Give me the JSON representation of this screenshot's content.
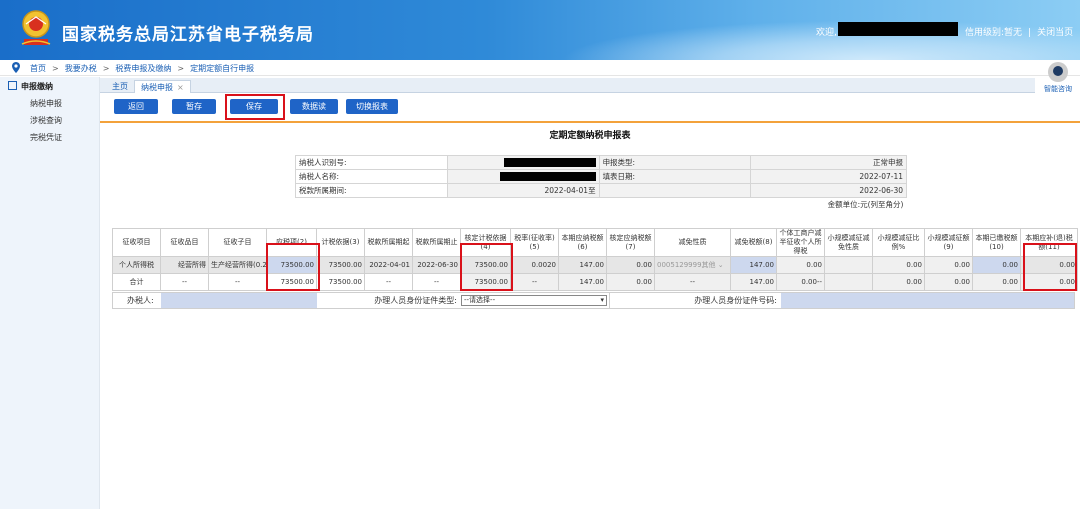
{
  "header": {
    "site_title": "国家税务总局江苏省电子税务局",
    "welcome": "欢迎,",
    "credit_label": "信用级别:暂无",
    "divider": "|",
    "close_label": "关闭当页"
  },
  "breadcrumb": [
    "首页",
    "我要办税",
    "税费申报及缴纳",
    "定期定额自行申报"
  ],
  "breadcrumb_sep": ">",
  "sidebar": {
    "heading": "申报缴纳",
    "items": [
      "纳税申报",
      "涉税查询",
      "完税凭证"
    ]
  },
  "tabs": {
    "home": "主页",
    "active": "纳税申报",
    "close": "×"
  },
  "assistant": {
    "label": "智能咨询"
  },
  "toolbar": {
    "back": "返回",
    "stash": "暂存",
    "save": "保存",
    "fetch": "数据读取",
    "switch": "切换报表"
  },
  "form_title": "定期定额纳税申报表",
  "info": {
    "taxpayer_id_label": "纳税人识别号:",
    "report_type_label": "申报类型:",
    "report_type_value": "正常申报",
    "taxpayer_name_label": "纳税人名称:",
    "fill_date_label": "填表日期:",
    "fill_date_value": "2022-07-11",
    "period_label": "税款所属期间:",
    "period_start": "2022-04-01",
    "period_to": "至",
    "period_end": "2022-06-30",
    "unit_note": "金额单位:元(列至角分)"
  },
  "table": {
    "headers": [
      "征收项目",
      "征收品目",
      "征收子目",
      "应税项(2)",
      "计税依据(3)",
      "税款所属期起",
      "税款所属期止",
      "核定计税依据(4)",
      "税率(征收率)(5)",
      "本期应纳税额(6)",
      "核定应纳税额(7)",
      "减免性质",
      "减免税额(8)",
      "个体工商户减半征收个人所得税",
      "小规模减征减免性质",
      "小规模减征比例%",
      "小规模减征额(9)",
      "本期已缴税额(10)",
      "本期应补(退)税额(11)"
    ],
    "row1": {
      "item": "个人所得税",
      "category": "经营所得",
      "subcategory": "生产经营所得(0.2%",
      "taxable": "73500.00",
      "basis": "73500.00",
      "start": "2022-04-01",
      "end": "2022-06-30",
      "approved_basis": "73500.00",
      "rate": "0.0020",
      "payable": "147.00",
      "approved_payable": "0.00",
      "relief_type": "0005129999其他",
      "relief_amount": "147.00",
      "half_relief": "0.00",
      "small_type": "",
      "small_ratio": "0.00",
      "small_amount": "0.00",
      "paid": "0.00",
      "due": "0.00"
    },
    "row2": {
      "item": "合计",
      "category": "--",
      "subcategory": "--",
      "taxable": "73500.00",
      "basis": "73500.00",
      "start": "--",
      "end": "--",
      "approved_basis": "73500.00",
      "rate": "--",
      "payable": "147.00",
      "approved_payable": "0.00",
      "relief_type": "--",
      "relief_amount": "147.00",
      "half_relief": "0.00--",
      "small_type": "",
      "small_ratio": "0.00",
      "small_amount": "0.00",
      "paid": "0.00",
      "due": "0.00"
    }
  },
  "bottom": {
    "handler_label": "办税人:",
    "id_type_label": "办理人员身份证件类型:",
    "id_type_placeholder": "--请选择--",
    "id_number_label": "办理人员身份证件号码:"
  }
}
